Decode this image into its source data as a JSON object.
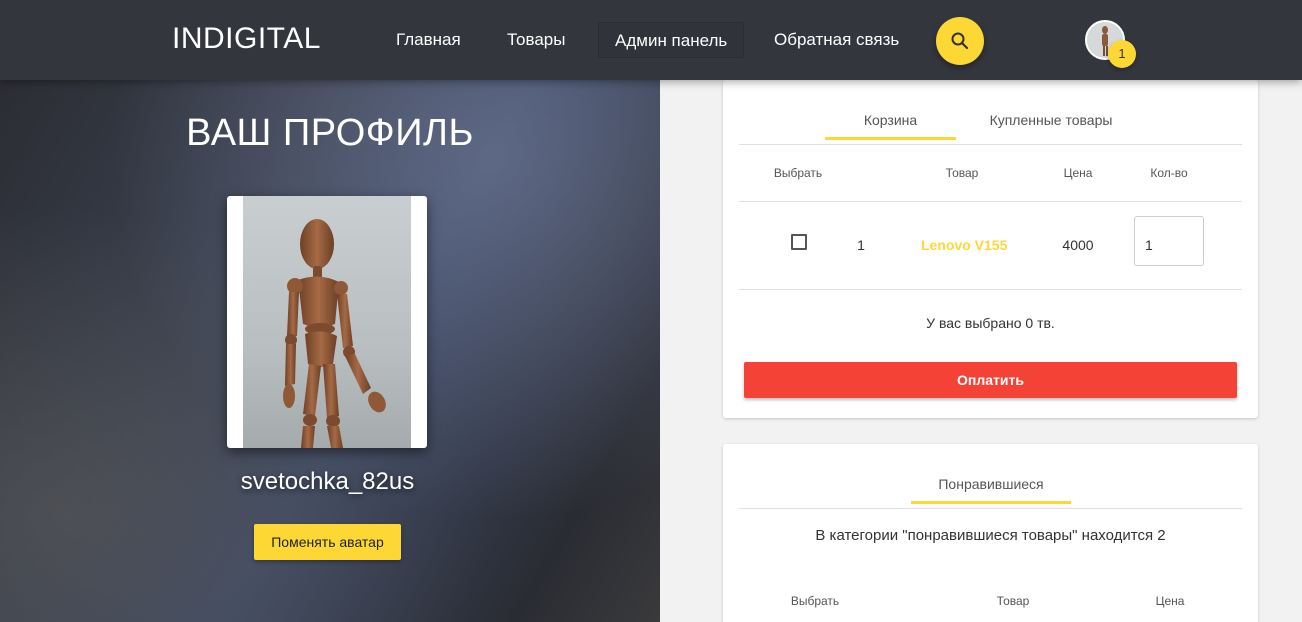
{
  "header": {
    "brand": "INDIGITAL",
    "nav": [
      {
        "label": "Главная"
      },
      {
        "label": "Товары"
      },
      {
        "label": "Админ панель"
      },
      {
        "label": "Обратная связь"
      }
    ],
    "cart_count": "1",
    "search_icon": "search-icon"
  },
  "profile": {
    "title": "ВАШ ПРОФИЛЬ",
    "username": "svetochka_82us",
    "change_avatar_label": "Поменять аватар"
  },
  "cart_card": {
    "tabs": [
      {
        "label": "Корзина"
      },
      {
        "label": "Купленные товары"
      }
    ],
    "columns": {
      "select": "Выбрать",
      "product": "Товар",
      "price": "Цена",
      "qty": "Кол-во"
    },
    "rows": [
      {
        "num": "1",
        "product": "Lenovo V155",
        "price": "4000",
        "qty": "1"
      }
    ],
    "summary": "У вас выбрано 0 тв.",
    "pay_label": "Оплатить"
  },
  "liked_card": {
    "tab": "Понравившиеся",
    "info": "В категории \"понравившиеся товары\" находится 2",
    "columns": {
      "select": "Выбрать",
      "product": "Товар",
      "price": "Цена"
    }
  },
  "colors": {
    "accent": "#fdd835",
    "pay": "#f44336",
    "navbar": "#33363d"
  }
}
